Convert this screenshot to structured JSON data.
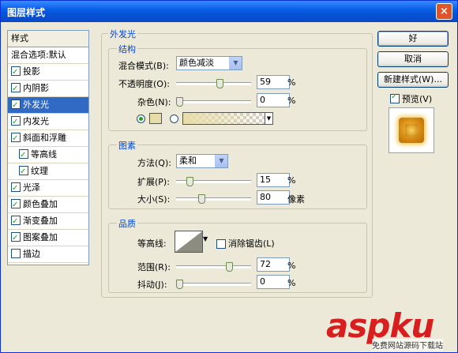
{
  "window": {
    "title": "图层样式",
    "close": "×"
  },
  "styles": {
    "header": "样式",
    "blend_options": "混合选项:默认",
    "items": [
      {
        "label": "投影",
        "checked": true,
        "selected": false,
        "sub": false
      },
      {
        "label": "内阴影",
        "checked": true,
        "selected": false,
        "sub": false
      },
      {
        "label": "外发光",
        "checked": true,
        "selected": true,
        "sub": false
      },
      {
        "label": "内发光",
        "checked": true,
        "selected": false,
        "sub": false
      },
      {
        "label": "斜面和浮雕",
        "checked": true,
        "selected": false,
        "sub": false
      },
      {
        "label": "等高线",
        "checked": true,
        "selected": false,
        "sub": true
      },
      {
        "label": "纹理",
        "checked": true,
        "selected": false,
        "sub": true
      },
      {
        "label": "光泽",
        "checked": true,
        "selected": false,
        "sub": false
      },
      {
        "label": "颜色叠加",
        "checked": true,
        "selected": false,
        "sub": false
      },
      {
        "label": "渐变叠加",
        "checked": true,
        "selected": false,
        "sub": false
      },
      {
        "label": "图案叠加",
        "checked": true,
        "selected": false,
        "sub": false
      },
      {
        "label": "描边",
        "checked": false,
        "selected": false,
        "sub": false
      }
    ]
  },
  "outer_glow": {
    "title": "外发光",
    "structure": {
      "title": "结构",
      "blend_mode_label": "混合模式(B):",
      "blend_mode_value": "颜色减淡",
      "opacity_label": "不透明度(O):",
      "opacity_value": "59",
      "opacity_fraction": 0.59,
      "noise_label": "杂色(N):",
      "noise_value": "0",
      "noise_fraction": 0,
      "percent": "%"
    },
    "elements": {
      "title": "图素",
      "method_label": "方法(Q):",
      "method_value": "柔和",
      "spread_label": "扩展(P):",
      "spread_value": "15",
      "spread_fraction": 0.15,
      "size_label": "大小(S):",
      "size_value": "80",
      "size_fraction": 0.32,
      "percent": "%",
      "pixels": "像素"
    },
    "quality": {
      "title": "品质",
      "contour_label": "等高线:",
      "antialias_label": "消除锯齿(L)",
      "range_label": "范围(R):",
      "range_value": "72",
      "range_fraction": 0.72,
      "jitter_label": "抖动(J):",
      "jitter_value": "0",
      "jitter_fraction": 0,
      "percent": "%"
    }
  },
  "buttons": {
    "ok": "好",
    "cancel": "取消",
    "new_style": "新建样式(W)...",
    "preview": "预览(V)"
  },
  "watermark": {
    "brand": "aspku",
    "sub": "免费网站源码下载站"
  }
}
